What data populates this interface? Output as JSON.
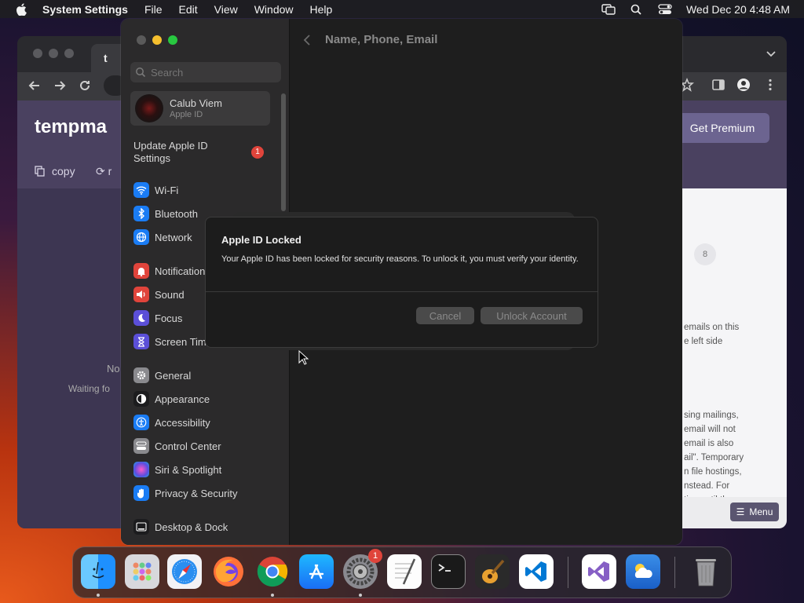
{
  "menubar": {
    "app_name": "System Settings",
    "menus": [
      "File",
      "Edit",
      "View",
      "Window",
      "Help"
    ],
    "clock": "Wed Dec 20  4:48 AM"
  },
  "browser": {
    "tab_title": "t",
    "brand": "tempma",
    "copy_label": "copy",
    "refresh_label": "r",
    "premium_label": "Get Premium",
    "counter": "8",
    "no_emails_text": "No",
    "waiting_text": "Waiting fo",
    "right_paragraph_1": [
      "emails on this",
      "e left side"
    ],
    "right_paragraph_2": [
      "sing mailings,",
      "email will not",
      "email is also",
      "ail\". Temporary",
      "n file hostings,",
      "nstead. For",
      "tion until they"
    ],
    "menu_label": "Menu"
  },
  "settings": {
    "search_placeholder": "Search",
    "account_name": "Calub Viem",
    "account_sub": "Apple ID",
    "update_label": "Update Apple ID Settings",
    "update_badge": "1",
    "content_title": "Name, Phone, Email",
    "items": [
      {
        "label": "Wi-Fi",
        "color": "#1a7cf4",
        "icon": "wifi-icon"
      },
      {
        "label": "Bluetooth",
        "color": "#1a7cf4",
        "icon": "bluetooth-icon"
      },
      {
        "label": "Network",
        "color": "#1a7cf4",
        "icon": "globe-icon"
      },
      {
        "label": "Notifications",
        "color": "#e0443b",
        "icon": "bell-icon"
      },
      {
        "label": "Sound",
        "color": "#e0443b",
        "icon": "speaker-icon"
      },
      {
        "label": "Focus",
        "color": "#5b4fd8",
        "icon": "moon-icon"
      },
      {
        "label": "Screen Time",
        "color": "#5b4fd8",
        "icon": "hourglass-icon"
      },
      {
        "label": "General",
        "color": "#8a8a8e",
        "icon": "gear-icon"
      },
      {
        "label": "Appearance",
        "color": "#1c1c1e",
        "icon": "appearance-icon"
      },
      {
        "label": "Accessibility",
        "color": "#1a7cf4",
        "icon": "accessibility-icon"
      },
      {
        "label": "Control Center",
        "color": "#8a8a8e",
        "icon": "control-center-icon"
      },
      {
        "label": "Siri & Spotlight",
        "color": "#a04ce0",
        "icon": "siri-icon"
      },
      {
        "label": "Privacy & Security",
        "color": "#1a7cf4",
        "icon": "hand-icon"
      },
      {
        "label": "Desktop & Dock",
        "color": "#1c1c1e",
        "icon": "dock-icon"
      }
    ]
  },
  "dialog": {
    "title": "Apple ID Locked",
    "message": "Your Apple ID has been locked for security reasons. To unlock it, you must verify your identity.",
    "cancel_label": "Cancel",
    "unlock_label": "Unlock Account"
  },
  "dock": {
    "apps": [
      "finder-icon",
      "launchpad-icon",
      "safari-icon",
      "firefox-icon",
      "chrome-icon",
      "app-store-icon",
      "system-settings-icon",
      "textedit-icon",
      "terminal-icon",
      "garageband-icon",
      "vscode-icon",
      "visual-studio-icon",
      "weather-icon",
      "trash-icon"
    ],
    "settings_badge": "1"
  },
  "colors": {
    "accent": "#1a7cf4",
    "badge": "#e0443b",
    "premium": "#6c6490",
    "site_header": "#4a4160"
  }
}
